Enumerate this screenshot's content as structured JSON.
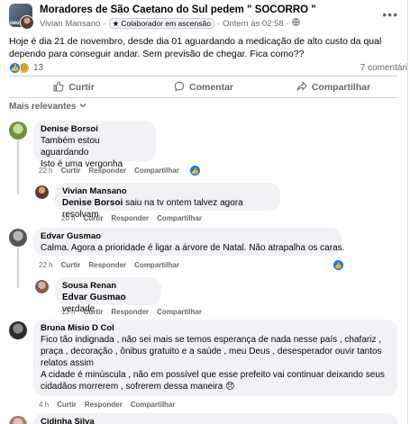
{
  "post": {
    "group_name": "Moradores de São Caetano do Sul pedem \" SOCORRO \"",
    "author": "Vivian Mansano",
    "separator": "·",
    "badge_icon": "star-icon",
    "badge": "Colaborador em ascensão",
    "time": "Ontem às 02:58",
    "privacy_icon": "globe-icon",
    "group_avatar_text": "oeus",
    "text": "Hoje é dia 21 de novembro, desde dia 01 aguardando a medicação de alto custo da qual dependo para conseguir andar. Sem previsão de chegar. Fica como??",
    "reaction_count": "13",
    "comments_count": "7 comentári",
    "actions": {
      "like": "Curtir",
      "comment": "Comentar",
      "share": "Compartilhar"
    },
    "sort_label": "Mais relevantes"
  },
  "comments": [
    {
      "name": "Denise Borsoi",
      "lines": [
        "Também estou aguardando",
        "Isto é uma vergonha"
      ],
      "time": "22 h",
      "like": "Curtir",
      "reply": "Responder",
      "share": "Compartilhar",
      "avatar_color": "#8fae62"
    },
    {
      "name": "Vivian Mansano",
      "mention": "Denise Borsoi",
      "rest": " saiu na tv ontem talvez agora resolvam",
      "time": "20 h",
      "like": "Curtir",
      "reply": "Responder",
      "share": "Compartilhar",
      "avatar_color": "#7a5240"
    },
    {
      "name": "Edvar Gusmao",
      "lines": [
        "Calma. Agora a prioridade é ligar a árvore de Natal. Não atrapalha os caras."
      ],
      "time": "22 h",
      "like": "Curtir",
      "reply": "Responder",
      "share": "Compartilhar",
      "avatar_color": "#6b6b6b"
    },
    {
      "name": "Sousa Renan",
      "mention": "Edvar Gusmao",
      "rest": " verdade",
      "time": "13 h",
      "like": "Curtir",
      "reply": "Responder",
      "share": "Compartilhar",
      "avatar_color": "#9a6b5a"
    },
    {
      "name": "Bruna Misio D Col",
      "lines": [
        "Fico tão indignada , não sei mais se temos esperança de nada nesse país , chafariz ,",
        "praça , decoração , ônibus gratuito e a saúde , meu Deus , desesperador ouvir tantos",
        "relatos assim",
        "A cidade é minúscula , não em possível que esse prefeito vai continuar deixando seus",
        "cidadãos morrerem , sofrerem dessa maneira 😞"
      ],
      "time": "4 h",
      "like": "Curtir",
      "reply": "Responder",
      "share": "Compartilhar",
      "avatar_color": "#3b3b3b"
    },
    {
      "name": "Cidinha Silva",
      "avatar_color": "#c99b88"
    }
  ],
  "colors": {
    "accent": "#1877f2",
    "muted": "#65676b",
    "bubble": "#f0f2f5"
  }
}
